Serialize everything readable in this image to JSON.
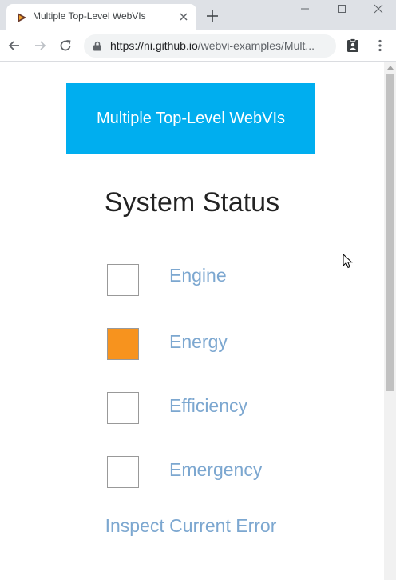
{
  "browser": {
    "tab_title": "Multiple Top-Level WebVIs",
    "url_scheme": "https://",
    "url_host": "ni.github.io",
    "url_path": "/webvi-examples/Mult..."
  },
  "page": {
    "banner_text": "Multiple Top-Level WebVIs",
    "title": "System Status",
    "indicators": [
      {
        "label": "Engine",
        "state": "off"
      },
      {
        "label": "Energy",
        "state": "on"
      },
      {
        "label": "Efficiency",
        "state": "off"
      },
      {
        "label": "Emergency",
        "state": "off"
      }
    ],
    "link_text": "Inspect Current Error"
  },
  "colors": {
    "banner": "#00aeef",
    "indicator_on": "#f7931e",
    "indicator_off": "#ffffff",
    "label": "#7ca7d0"
  }
}
